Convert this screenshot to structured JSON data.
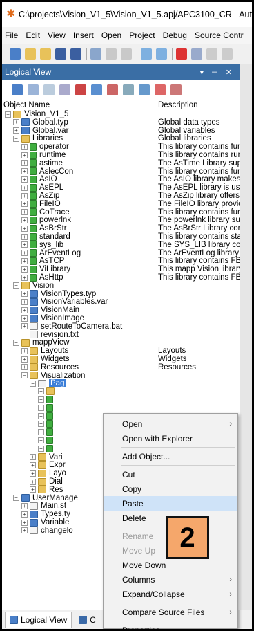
{
  "window": {
    "title": "C:\\projects\\Vision_V1_5\\Vision_V1_5.apj/APC3100_CR - Aut"
  },
  "menu": [
    "File",
    "Edit",
    "View",
    "Insert",
    "Open",
    "Project",
    "Debug",
    "Source Contr"
  ],
  "panel": {
    "title": "Logical View",
    "controls": "▾ ⊣ ✕"
  },
  "columns": {
    "name": "Object Name",
    "description": "Description"
  },
  "tree": [
    {
      "level": 0,
      "exp": "-",
      "icon": "folder-icon",
      "label": "Vision_V1_5",
      "desc": ""
    },
    {
      "level": 1,
      "exp": "+",
      "icon": "types-icon",
      "label": "Global.typ",
      "desc": "Global data types"
    },
    {
      "level": 1,
      "exp": "+",
      "icon": "var-icon",
      "label": "Global.var",
      "desc": "Global variables"
    },
    {
      "level": 1,
      "exp": "-",
      "icon": "folder-icon",
      "label": "Libraries",
      "desc": "Global libraries"
    },
    {
      "level": 2,
      "exp": "+",
      "icon": "library-icon",
      "label": "operator",
      "desc": "This library contains func"
    },
    {
      "level": 2,
      "exp": "+",
      "icon": "library-icon",
      "label": "runtime",
      "desc": "This library contains runt"
    },
    {
      "level": 2,
      "exp": "+",
      "icon": "library-icon",
      "label": "astime",
      "desc": "The AsTime Library sup"
    },
    {
      "level": 2,
      "exp": "+",
      "icon": "library-icon",
      "label": "AslecCon",
      "desc": "This library contains func"
    },
    {
      "level": 2,
      "exp": "+",
      "icon": "library-icon",
      "label": "AsIO",
      "desc": "The AsIO library makes"
    },
    {
      "level": 2,
      "exp": "+",
      "icon": "library-icon",
      "label": "AsEPL",
      "desc": "The AsEPL library is use"
    },
    {
      "level": 2,
      "exp": "+",
      "icon": "library-icon",
      "label": "AsZip",
      "desc": "The AsZip library offers"
    },
    {
      "level": 2,
      "exp": "+",
      "icon": "library-icon",
      "label": "FileIO",
      "desc": "The FileIO library provid"
    },
    {
      "level": 2,
      "exp": "+",
      "icon": "library-icon",
      "label": "CoTrace",
      "desc": "This library contains func"
    },
    {
      "level": 2,
      "exp": "+",
      "icon": "library-icon",
      "label": "powerlnk",
      "desc": "The powerlnk library sup"
    },
    {
      "level": 2,
      "exp": "+",
      "icon": "library-icon",
      "label": "AsBrStr",
      "desc": "The AsBrStr Library con"
    },
    {
      "level": 2,
      "exp": "+",
      "icon": "library-icon",
      "label": "standard",
      "desc": "This library contains sta"
    },
    {
      "level": 2,
      "exp": "+",
      "icon": "library-icon",
      "label": "sys_lib",
      "desc": "The SYS_LIB library cor"
    },
    {
      "level": 2,
      "exp": "+",
      "icon": "library-icon",
      "label": "ArEventLog",
      "desc": "The ArEventLog library"
    },
    {
      "level": 2,
      "exp": "+",
      "icon": "library-icon",
      "label": "AsTCP",
      "desc": "This library contains FBI"
    },
    {
      "level": 2,
      "exp": "+",
      "icon": "library-icon",
      "label": "ViLibrary",
      "desc": "This mapp Vision library"
    },
    {
      "level": 2,
      "exp": "+",
      "icon": "library-icon",
      "label": "AsHttp",
      "desc": "This library contains FBI"
    },
    {
      "level": 1,
      "exp": "-",
      "icon": "folder-icon",
      "label": "Vision",
      "desc": ""
    },
    {
      "level": 2,
      "exp": "+",
      "icon": "types-icon",
      "label": "VisionTypes.typ",
      "desc": ""
    },
    {
      "level": 2,
      "exp": "+",
      "icon": "var-icon",
      "label": "VisionVariables.var",
      "desc": ""
    },
    {
      "level": 2,
      "exp": "+",
      "icon": "program-icon",
      "label": "VisionMain",
      "desc": ""
    },
    {
      "level": 2,
      "exp": "+",
      "icon": "program-icon",
      "label": "VisionImage",
      "desc": ""
    },
    {
      "level": 2,
      "exp": "+",
      "icon": "file-icon",
      "label": "setRouteToCamera.bat",
      "desc": ""
    },
    {
      "level": 2,
      "exp": "",
      "icon": "file-icon",
      "label": "revision.txt",
      "desc": ""
    },
    {
      "level": 1,
      "exp": "-",
      "icon": "folder-icon",
      "label": "mappView",
      "desc": ""
    },
    {
      "level": 2,
      "exp": "+",
      "icon": "folder-icon",
      "label": "Layouts",
      "desc": "Layouts"
    },
    {
      "level": 2,
      "exp": "+",
      "icon": "folder-icon",
      "label": "Widgets",
      "desc": "Widgets"
    },
    {
      "level": 2,
      "exp": "+",
      "icon": "folder-icon",
      "label": "Resources",
      "desc": "Resources"
    },
    {
      "level": 2,
      "exp": "-",
      "icon": "folder-icon",
      "label": "Visualization",
      "desc": ""
    },
    {
      "level": 3,
      "exp": "-",
      "icon": "page-icon",
      "label": "Pag",
      "desc": "",
      "selected": true
    },
    {
      "level": 4,
      "exp": "+",
      "icon": "folder-icon",
      "label": "",
      "desc": ""
    },
    {
      "level": 4,
      "exp": "+",
      "icon": "content-icon",
      "label": "",
      "desc": ""
    },
    {
      "level": 4,
      "exp": "+",
      "icon": "content-icon",
      "label": "",
      "desc": ""
    },
    {
      "level": 4,
      "exp": "+",
      "icon": "content-icon",
      "label": "",
      "desc": ""
    },
    {
      "level": 4,
      "exp": "+",
      "icon": "content-icon",
      "label": "",
      "desc": ""
    },
    {
      "level": 4,
      "exp": "+",
      "icon": "content-icon",
      "label": "",
      "desc": ""
    },
    {
      "level": 4,
      "exp": "+",
      "icon": "content-icon",
      "label": "",
      "desc": ""
    },
    {
      "level": 4,
      "exp": "+",
      "icon": "content-icon",
      "label": "",
      "desc": ""
    },
    {
      "level": 3,
      "exp": "+",
      "icon": "folder-icon",
      "label": "Vari",
      "desc": ""
    },
    {
      "level": 3,
      "exp": "+",
      "icon": "folder-icon",
      "label": "Expr",
      "desc": ""
    },
    {
      "level": 3,
      "exp": "+",
      "icon": "folder-icon",
      "label": "Layo",
      "desc": ""
    },
    {
      "level": 3,
      "exp": "+",
      "icon": "folder-icon",
      "label": "Dial",
      "desc": ""
    },
    {
      "level": 3,
      "exp": "+",
      "icon": "folder-icon",
      "label": "Res",
      "desc": ""
    },
    {
      "level": 1,
      "exp": "-",
      "icon": "program-icon",
      "label": "UserManage",
      "desc": ""
    },
    {
      "level": 2,
      "exp": "+",
      "icon": "file-icon",
      "label": "Main.st",
      "desc": ""
    },
    {
      "level": 2,
      "exp": "+",
      "icon": "types-icon",
      "label": "Types.ty",
      "desc": ""
    },
    {
      "level": 2,
      "exp": "+",
      "icon": "var-icon",
      "label": "Variable",
      "desc": ""
    },
    {
      "level": 2,
      "exp": "+",
      "icon": "file-icon",
      "label": "changelo",
      "desc": ""
    }
  ],
  "context_menu": [
    {
      "label": "Open",
      "submenu": true,
      "disabled": false
    },
    {
      "label": "Open with Explorer",
      "submenu": false,
      "disabled": false
    },
    {
      "sep": true
    },
    {
      "label": "Add Object...",
      "submenu": false,
      "disabled": false
    },
    {
      "sep": true
    },
    {
      "label": "Cut",
      "submenu": false,
      "disabled": false
    },
    {
      "label": "Copy",
      "submenu": false,
      "disabled": false
    },
    {
      "label": "Paste",
      "submenu": false,
      "disabled": false,
      "highlighted": true
    },
    {
      "label": "Delete",
      "submenu": false,
      "disabled": false
    },
    {
      "sep": true
    },
    {
      "label": "Rename",
      "submenu": false,
      "disabled": true
    },
    {
      "label": "Move Up",
      "submenu": false,
      "disabled": true
    },
    {
      "label": "Move Down",
      "submenu": false,
      "disabled": false
    },
    {
      "label": "Columns",
      "submenu": true,
      "disabled": false
    },
    {
      "label": "Expand/Collapse",
      "submenu": true,
      "disabled": false
    },
    {
      "sep": true
    },
    {
      "label": "Compare Source Files",
      "submenu": true,
      "disabled": false
    },
    {
      "sep": true
    },
    {
      "label": "Properties...",
      "submenu": false,
      "disabled": false
    }
  ],
  "bottom_tabs": [
    {
      "label": "Logical View",
      "active": true
    },
    {
      "label": "C",
      "active": false
    }
  ],
  "step_badge": "2",
  "colors": {
    "panel_title": "#3a6ea5",
    "selection": "#3c7fd8",
    "badge": "#f5a76b",
    "menu_highlight": "#cfe3f8"
  }
}
